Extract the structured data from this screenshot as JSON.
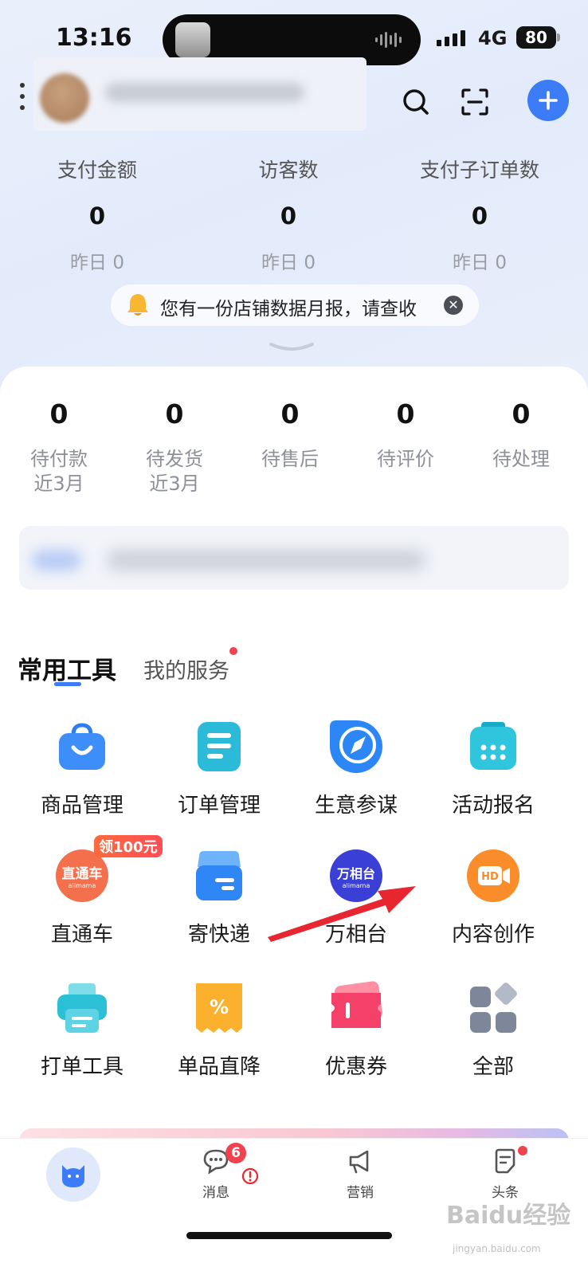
{
  "status_bar": {
    "time": "13:16",
    "network": "4G",
    "battery": "80"
  },
  "stats": [
    {
      "label": "支付金额",
      "value": "0",
      "sub": "昨日 0"
    },
    {
      "label": "访客数",
      "value": "0",
      "sub": "昨日 0"
    },
    {
      "label": "支付子订单数",
      "value": "0",
      "sub": "昨日 0"
    }
  ],
  "notice": {
    "text": "您有一份店铺数据月报，请查收"
  },
  "orders": [
    {
      "value": "0",
      "label": "待付款",
      "sub": "近3月"
    },
    {
      "value": "0",
      "label": "待发货",
      "sub": "近3月"
    },
    {
      "value": "0",
      "label": "待售后",
      "sub": ""
    },
    {
      "value": "0",
      "label": "待评价",
      "sub": ""
    },
    {
      "value": "0",
      "label": "待处理",
      "sub": ""
    }
  ],
  "tabs": {
    "active": "常用工具",
    "other": "我的服务"
  },
  "tools": [
    {
      "label": "商品管理",
      "icon": "shopping-bag-icon"
    },
    {
      "label": "订单管理",
      "icon": "order-list-icon"
    },
    {
      "label": "生意参谋",
      "icon": "compass-icon"
    },
    {
      "label": "活动报名",
      "icon": "calendar-icon"
    },
    {
      "label": "直通车",
      "icon": "ztc-icon",
      "icon_text": "直通车",
      "icon_sub": "alimama",
      "badge": "领100元"
    },
    {
      "label": "寄快递",
      "icon": "parcel-box-icon"
    },
    {
      "label": "万相台",
      "icon": "wanxiangtai-icon",
      "icon_text": "万相台",
      "icon_sub": "alimama"
    },
    {
      "label": "内容创作",
      "icon": "hd-video-icon",
      "icon_text": "HD"
    },
    {
      "label": "打单工具",
      "icon": "printer-icon"
    },
    {
      "label": "单品直降",
      "icon": "discount-ticket-icon"
    },
    {
      "label": "优惠券",
      "icon": "coupon-icon"
    },
    {
      "label": "全部",
      "icon": "grid-all-icon"
    }
  ],
  "bottom_nav": {
    "messages_label": "消息",
    "messages_badge": "6",
    "marketing_label": "营销",
    "headlines_label": "头条"
  },
  "watermark": {
    "text": "Baidu经验",
    "sub": "jingyan.baidu.com"
  },
  "colors": {
    "accent": "#3d7cf7",
    "badge_red": "#f0424f",
    "arrow_red": "#e8262f"
  }
}
